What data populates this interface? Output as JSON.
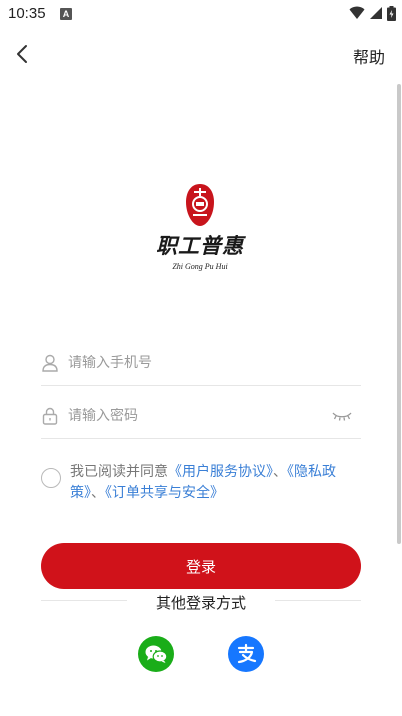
{
  "status_bar": {
    "time": "10:35",
    "notification_badge": "A",
    "icons": [
      "wifi-icon",
      "signal-icon",
      "battery-icon"
    ]
  },
  "topbar": {
    "back_icon": "chevron-left-icon",
    "help_label": "帮助"
  },
  "logo": {
    "title": "职工普惠",
    "subtitle": "Zhi Gong Pu Hui",
    "seal_color": "#c8141c"
  },
  "form": {
    "phone": {
      "placeholder": "请输入手机号",
      "value": "",
      "icon": "user-icon"
    },
    "password": {
      "placeholder": "请输入密码",
      "value": "",
      "icon": "lock-icon",
      "toggle_icon": "eye-closed-icon"
    }
  },
  "agreement": {
    "checked": false,
    "prefix": "我已阅读并同意",
    "link_service": "《用户服务协议》",
    "sep1": "、",
    "link_privacy": "《隐私政策》",
    "sep2": "、",
    "link_order": "《订单共享与安全》"
  },
  "login_button": {
    "label": "登录",
    "color": "#d0121a"
  },
  "other_login": {
    "title": "其他登录方式",
    "options": [
      {
        "name": "wechat",
        "icon": "wechat-icon",
        "color": "#1aad19"
      },
      {
        "name": "alipay",
        "icon": "alipay-icon",
        "color": "#1677ff"
      }
    ]
  }
}
